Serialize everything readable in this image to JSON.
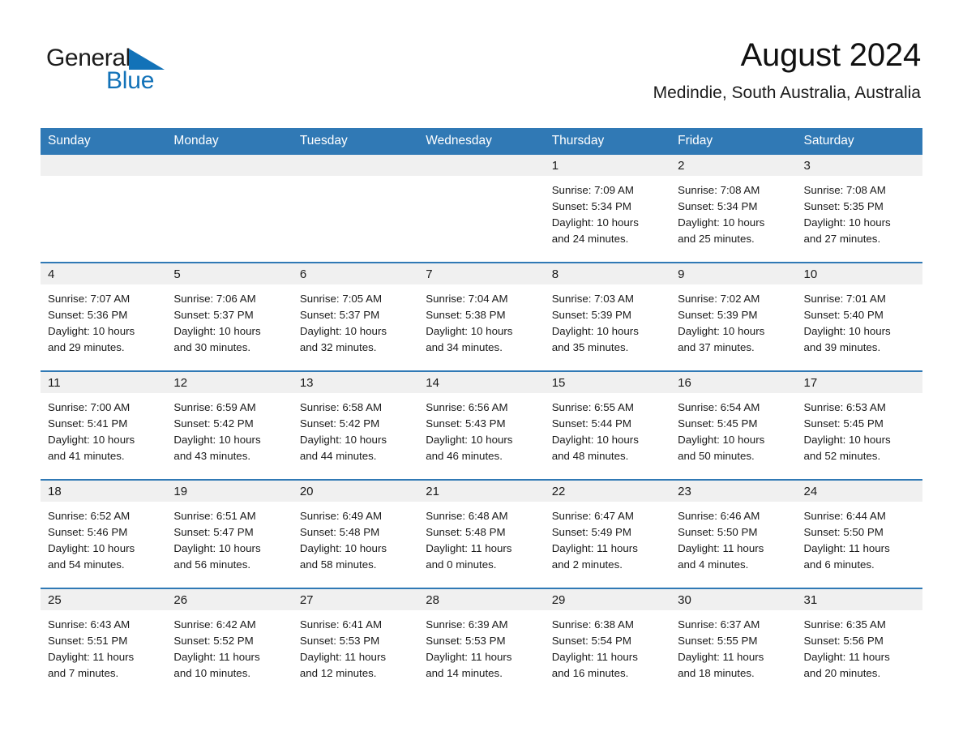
{
  "brand": {
    "name_part1": "General",
    "name_part2": "Blue",
    "accent_color": "#1272b8"
  },
  "header": {
    "title": "August 2024",
    "subtitle": "Medindie, South Australia, Australia"
  },
  "theme": {
    "header_blue": "#3079b5",
    "band_gray": "#f0f0f0"
  },
  "weekday_headers": [
    "Sunday",
    "Monday",
    "Tuesday",
    "Wednesday",
    "Thursday",
    "Friday",
    "Saturday"
  ],
  "weeks": [
    [
      {
        "day": "",
        "sunrise": "",
        "sunset": "",
        "daylight_line1": "",
        "daylight_line2": "",
        "empty": true
      },
      {
        "day": "",
        "sunrise": "",
        "sunset": "",
        "daylight_line1": "",
        "daylight_line2": "",
        "empty": true
      },
      {
        "day": "",
        "sunrise": "",
        "sunset": "",
        "daylight_line1": "",
        "daylight_line2": "",
        "empty": true
      },
      {
        "day": "",
        "sunrise": "",
        "sunset": "",
        "daylight_line1": "",
        "daylight_line2": "",
        "empty": true
      },
      {
        "day": "1",
        "sunrise": "Sunrise: 7:09 AM",
        "sunset": "Sunset: 5:34 PM",
        "daylight_line1": "Daylight: 10 hours",
        "daylight_line2": "and 24 minutes.",
        "empty": false
      },
      {
        "day": "2",
        "sunrise": "Sunrise: 7:08 AM",
        "sunset": "Sunset: 5:34 PM",
        "daylight_line1": "Daylight: 10 hours",
        "daylight_line2": "and 25 minutes.",
        "empty": false
      },
      {
        "day": "3",
        "sunrise": "Sunrise: 7:08 AM",
        "sunset": "Sunset: 5:35 PM",
        "daylight_line1": "Daylight: 10 hours",
        "daylight_line2": "and 27 minutes.",
        "empty": false
      }
    ],
    [
      {
        "day": "4",
        "sunrise": "Sunrise: 7:07 AM",
        "sunset": "Sunset: 5:36 PM",
        "daylight_line1": "Daylight: 10 hours",
        "daylight_line2": "and 29 minutes.",
        "empty": false
      },
      {
        "day": "5",
        "sunrise": "Sunrise: 7:06 AM",
        "sunset": "Sunset: 5:37 PM",
        "daylight_line1": "Daylight: 10 hours",
        "daylight_line2": "and 30 minutes.",
        "empty": false
      },
      {
        "day": "6",
        "sunrise": "Sunrise: 7:05 AM",
        "sunset": "Sunset: 5:37 PM",
        "daylight_line1": "Daylight: 10 hours",
        "daylight_line2": "and 32 minutes.",
        "empty": false
      },
      {
        "day": "7",
        "sunrise": "Sunrise: 7:04 AM",
        "sunset": "Sunset: 5:38 PM",
        "daylight_line1": "Daylight: 10 hours",
        "daylight_line2": "and 34 minutes.",
        "empty": false
      },
      {
        "day": "8",
        "sunrise": "Sunrise: 7:03 AM",
        "sunset": "Sunset: 5:39 PM",
        "daylight_line1": "Daylight: 10 hours",
        "daylight_line2": "and 35 minutes.",
        "empty": false
      },
      {
        "day": "9",
        "sunrise": "Sunrise: 7:02 AM",
        "sunset": "Sunset: 5:39 PM",
        "daylight_line1": "Daylight: 10 hours",
        "daylight_line2": "and 37 minutes.",
        "empty": false
      },
      {
        "day": "10",
        "sunrise": "Sunrise: 7:01 AM",
        "sunset": "Sunset: 5:40 PM",
        "daylight_line1": "Daylight: 10 hours",
        "daylight_line2": "and 39 minutes.",
        "empty": false
      }
    ],
    [
      {
        "day": "11",
        "sunrise": "Sunrise: 7:00 AM",
        "sunset": "Sunset: 5:41 PM",
        "daylight_line1": "Daylight: 10 hours",
        "daylight_line2": "and 41 minutes.",
        "empty": false
      },
      {
        "day": "12",
        "sunrise": "Sunrise: 6:59 AM",
        "sunset": "Sunset: 5:42 PM",
        "daylight_line1": "Daylight: 10 hours",
        "daylight_line2": "and 43 minutes.",
        "empty": false
      },
      {
        "day": "13",
        "sunrise": "Sunrise: 6:58 AM",
        "sunset": "Sunset: 5:42 PM",
        "daylight_line1": "Daylight: 10 hours",
        "daylight_line2": "and 44 minutes.",
        "empty": false
      },
      {
        "day": "14",
        "sunrise": "Sunrise: 6:56 AM",
        "sunset": "Sunset: 5:43 PM",
        "daylight_line1": "Daylight: 10 hours",
        "daylight_line2": "and 46 minutes.",
        "empty": false
      },
      {
        "day": "15",
        "sunrise": "Sunrise: 6:55 AM",
        "sunset": "Sunset: 5:44 PM",
        "daylight_line1": "Daylight: 10 hours",
        "daylight_line2": "and 48 minutes.",
        "empty": false
      },
      {
        "day": "16",
        "sunrise": "Sunrise: 6:54 AM",
        "sunset": "Sunset: 5:45 PM",
        "daylight_line1": "Daylight: 10 hours",
        "daylight_line2": "and 50 minutes.",
        "empty": false
      },
      {
        "day": "17",
        "sunrise": "Sunrise: 6:53 AM",
        "sunset": "Sunset: 5:45 PM",
        "daylight_line1": "Daylight: 10 hours",
        "daylight_line2": "and 52 minutes.",
        "empty": false
      }
    ],
    [
      {
        "day": "18",
        "sunrise": "Sunrise: 6:52 AM",
        "sunset": "Sunset: 5:46 PM",
        "daylight_line1": "Daylight: 10 hours",
        "daylight_line2": "and 54 minutes.",
        "empty": false
      },
      {
        "day": "19",
        "sunrise": "Sunrise: 6:51 AM",
        "sunset": "Sunset: 5:47 PM",
        "daylight_line1": "Daylight: 10 hours",
        "daylight_line2": "and 56 minutes.",
        "empty": false
      },
      {
        "day": "20",
        "sunrise": "Sunrise: 6:49 AM",
        "sunset": "Sunset: 5:48 PM",
        "daylight_line1": "Daylight: 10 hours",
        "daylight_line2": "and 58 minutes.",
        "empty": false
      },
      {
        "day": "21",
        "sunrise": "Sunrise: 6:48 AM",
        "sunset": "Sunset: 5:48 PM",
        "daylight_line1": "Daylight: 11 hours",
        "daylight_line2": "and 0 minutes.",
        "empty": false
      },
      {
        "day": "22",
        "sunrise": "Sunrise: 6:47 AM",
        "sunset": "Sunset: 5:49 PM",
        "daylight_line1": "Daylight: 11 hours",
        "daylight_line2": "and 2 minutes.",
        "empty": false
      },
      {
        "day": "23",
        "sunrise": "Sunrise: 6:46 AM",
        "sunset": "Sunset: 5:50 PM",
        "daylight_line1": "Daylight: 11 hours",
        "daylight_line2": "and 4 minutes.",
        "empty": false
      },
      {
        "day": "24",
        "sunrise": "Sunrise: 6:44 AM",
        "sunset": "Sunset: 5:50 PM",
        "daylight_line1": "Daylight: 11 hours",
        "daylight_line2": "and 6 minutes.",
        "empty": false
      }
    ],
    [
      {
        "day": "25",
        "sunrise": "Sunrise: 6:43 AM",
        "sunset": "Sunset: 5:51 PM",
        "daylight_line1": "Daylight: 11 hours",
        "daylight_line2": "and 7 minutes.",
        "empty": false
      },
      {
        "day": "26",
        "sunrise": "Sunrise: 6:42 AM",
        "sunset": "Sunset: 5:52 PM",
        "daylight_line1": "Daylight: 11 hours",
        "daylight_line2": "and 10 minutes.",
        "empty": false
      },
      {
        "day": "27",
        "sunrise": "Sunrise: 6:41 AM",
        "sunset": "Sunset: 5:53 PM",
        "daylight_line1": "Daylight: 11 hours",
        "daylight_line2": "and 12 minutes.",
        "empty": false
      },
      {
        "day": "28",
        "sunrise": "Sunrise: 6:39 AM",
        "sunset": "Sunset: 5:53 PM",
        "daylight_line1": "Daylight: 11 hours",
        "daylight_line2": "and 14 minutes.",
        "empty": false
      },
      {
        "day": "29",
        "sunrise": "Sunrise: 6:38 AM",
        "sunset": "Sunset: 5:54 PM",
        "daylight_line1": "Daylight: 11 hours",
        "daylight_line2": "and 16 minutes.",
        "empty": false
      },
      {
        "day": "30",
        "sunrise": "Sunrise: 6:37 AM",
        "sunset": "Sunset: 5:55 PM",
        "daylight_line1": "Daylight: 11 hours",
        "daylight_line2": "and 18 minutes.",
        "empty": false
      },
      {
        "day": "31",
        "sunrise": "Sunrise: 6:35 AM",
        "sunset": "Sunset: 5:56 PM",
        "daylight_line1": "Daylight: 11 hours",
        "daylight_line2": "and 20 minutes.",
        "empty": false
      }
    ]
  ]
}
